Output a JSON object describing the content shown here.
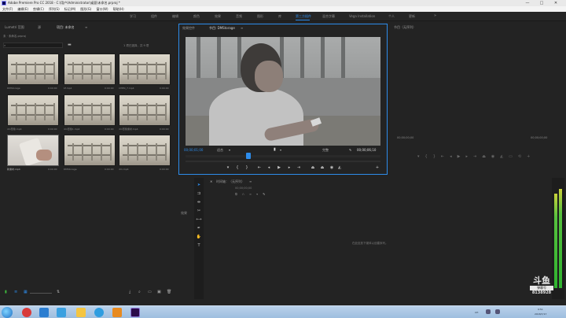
{
  "window": {
    "title": "Adobe Premiere Pro CC 2018 - C:\\用户\\Administrator\\桌面\\未命名.prproj *",
    "minimize": "—",
    "maximize": "□",
    "close": "✕"
  },
  "menu": [
    "文件(F)",
    "编辑(E)",
    "剪辑(C)",
    "序列(S)",
    "标记(M)",
    "图形(G)",
    "窗口(W)",
    "帮助(H)"
  ],
  "workspace_tabs": [
    "学习",
    "组件",
    "编辑",
    "颜色",
    "效果",
    "音频",
    "图形",
    "库",
    "第三方插件",
    "混合字幕",
    "Vega Installation",
    "个人",
    "更新"
  ],
  "workspace_active": "第三方插件",
  "project_panel": {
    "tabs": [
      "Lumetri 范围",
      "源",
      "项目: 未命名",
      "≡"
    ],
    "path": "未 · 未命名.prproj",
    "item_count": "1 项已选择，共 9 项",
    "folder_icon": "folder-icon",
    "clips": [
      {
        "name": "DMStorage",
        "duration": "0:00:00"
      },
      {
        "name": "bf.mp4",
        "duration": "0:00:00"
      },
      {
        "name": "CHEN_7.mp4",
        "duration": "0:00:00"
      },
      {
        "name": "dm形象.mp4",
        "duration": "0:00:00"
      },
      {
        "name": "dm形象1.mp4",
        "duration": "0:00:00"
      },
      {
        "name": "dm形象素材.mp4",
        "duration": "0:00:00"
      },
      {
        "name": "新素材.mp4",
        "duration": "0:00:00"
      },
      {
        "name": "DMStorage",
        "duration": "0:00:00"
      },
      {
        "name": "dm.mp4",
        "duration": "0:00:00"
      }
    ]
  },
  "program_monitor": {
    "tabs": [
      "效果控件",
      "节目: DMStorage",
      "≡"
    ],
    "timecode_current": "00;00;01;00",
    "fit": "适合",
    "quality": "完整",
    "timecode_total": "00;00;06;10"
  },
  "effect_panel": {
    "title": "节目（无序列）",
    "time_left": "00;00;00;00",
    "time_right": "00;00;00;00"
  },
  "timeline": {
    "title": "时间轴：（无序列）",
    "timecode": "00;00;00;00",
    "empty_message": "在此处放下媒体以创建序列。",
    "side_label": "效果"
  },
  "watermark": {
    "brand": "斗鱼",
    "sub": "弹幕号",
    "id": "8138928"
  },
  "taskbar": {
    "lang": "CH",
    "time": "9:51",
    "date": "2018/7/17"
  },
  "colors": {
    "accent": "#2d8ceb",
    "panel_bg": "#232323",
    "taskbar": "#b9d1ea"
  }
}
